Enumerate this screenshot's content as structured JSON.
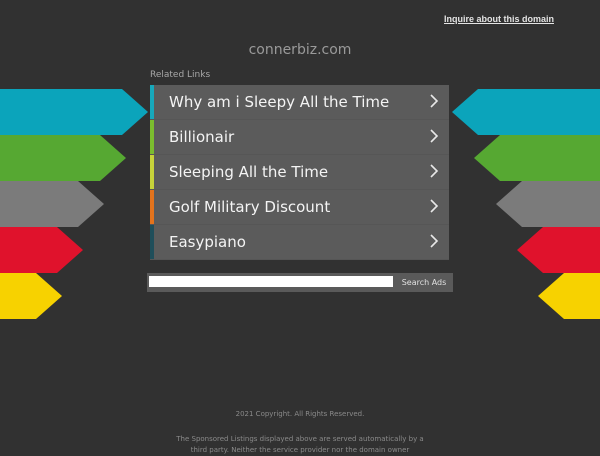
{
  "header": {
    "inquire_link": "Inquire about this domain",
    "domain": "connerbiz.com"
  },
  "related": {
    "heading": "Related Links",
    "items": [
      {
        "label": "Why am i Sleepy All the Time",
        "color": "#17a8bb"
      },
      {
        "label": "Billionair",
        "color": "#7bbd2e"
      },
      {
        "label": "Sleeping All the Time",
        "color": "#c7d33a"
      },
      {
        "label": "Golf Military Discount",
        "color": "#e3731c"
      },
      {
        "label": "Easypiano",
        "color": "#1f4e5a"
      }
    ]
  },
  "decor": {
    "arrow_colors": [
      "#0ba4bb",
      "#56a832",
      "#7b7b7b",
      "#e0122c",
      "#f7d200"
    ]
  },
  "search": {
    "placeholder": "",
    "button_label": "Search Ads"
  },
  "footer": {
    "copyright": "2021 Copyright. All Rights Reserved.",
    "disclaimer": "The Sponsored Listings displayed above are served automatically by a third party. Neither the service provider nor the domain owner"
  }
}
